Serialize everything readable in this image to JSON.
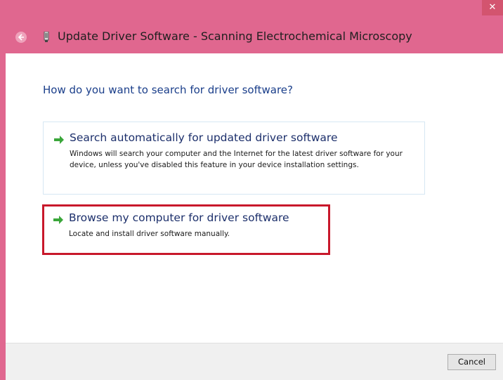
{
  "window": {
    "title": "Update Driver Software - Scanning Electrochemical Microscopy",
    "close_label": "✕"
  },
  "question": "How do you want to search for driver software?",
  "options": [
    {
      "title": "Search automatically for updated driver software",
      "description": "Windows will search your computer and the Internet for the latest driver software for your device, unless you've disabled this feature in your device installation settings.",
      "icon": "green-arrow-icon"
    },
    {
      "title": "Browse my computer for driver software",
      "description": "Locate and install driver software manually.",
      "icon": "green-arrow-icon",
      "highlighted": true
    }
  ],
  "footer": {
    "cancel_label": "Cancel"
  },
  "colors": {
    "title_bar": "#e0678f",
    "question_text": "#1a3e8a",
    "highlight_border": "#c8182b",
    "arrow": "#3aa63a"
  }
}
